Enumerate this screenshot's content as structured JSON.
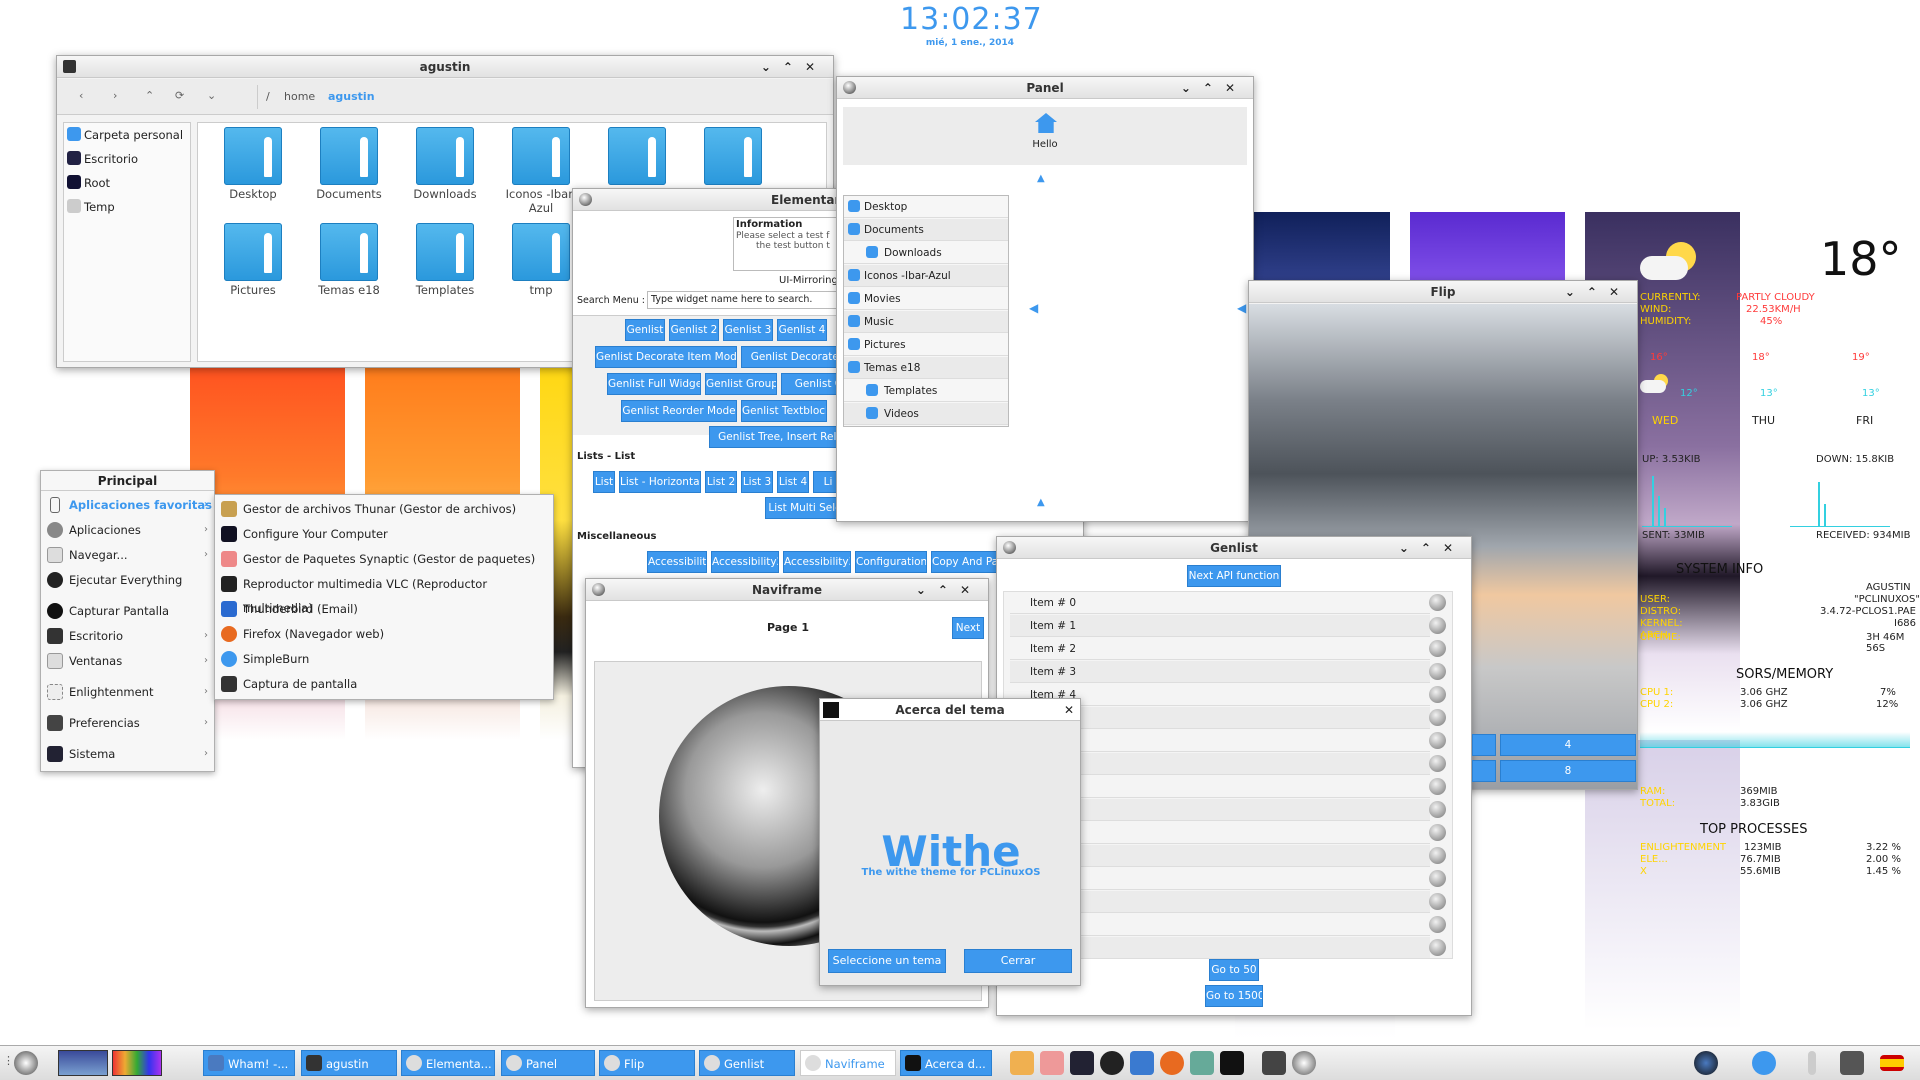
{
  "clock": {
    "time_a": "1",
    "time_b": "3",
    "time_c": "02",
    "time_d": "37",
    "date": "mié,  1 ene., 2014"
  },
  "filemanager": {
    "title": "agustin",
    "path": [
      "/",
      "home",
      "agustin"
    ],
    "places": [
      "Carpeta personal",
      "Escritorio",
      "Root",
      "Temp"
    ],
    "folders": [
      "Desktop",
      "Documents",
      "Downloads",
      "Iconos -Ibar-Azul",
      "",
      "",
      "Pictures",
      "Temas e18",
      "Templates",
      "tmp"
    ]
  },
  "elementary": {
    "title": "Elementar",
    "info_header": "Information",
    "info_text_1": "Please select a test f",
    "info_text_2": "the test button t",
    "mirroring": "UI-Mirroring",
    "search_label": "Search Menu :",
    "search_placeholder": "Type widget name here to search.",
    "genlist_buttons": [
      "Genlist",
      "Genlist 2",
      "Genlist 3",
      "Genlist 4",
      "Genlist Decorate Item Mode",
      "Genlist Decorate M",
      "Genlist Full Widget",
      "Genlist Group",
      "Genlist Gr",
      "Genlist Reorder Mode",
      "Genlist Textblock",
      "Genlist Tree, Insert Relati"
    ],
    "lists_header": "Lists - List",
    "list_buttons": [
      "List",
      "List - Horizontal",
      "List 2",
      "List 3",
      "List 4",
      "Li",
      "List Multi Sele"
    ],
    "misc_header": "Miscellaneous",
    "misc_buttons": [
      "Accessibility",
      "Accessibility2",
      "Accessibility3",
      "Configuration",
      "Copy And Paste"
    ]
  },
  "panel": {
    "title": "Panel",
    "hello": "Hello",
    "tree": [
      "Desktop",
      "Documents",
      "Downloads",
      "Iconos -Ibar-Azul",
      "Movies",
      "Music",
      "Pictures",
      "Temas e18",
      "Templates",
      "Videos"
    ]
  },
  "flip": {
    "title": "Flip"
  },
  "conky": {
    "temp": "18°",
    "current_label": "CURRENTLY:",
    "current_val": "PARTLY CLOUDY",
    "wind_label": "WIND:",
    "wind_val": "22.53KM/H",
    "hum_label": "HUMIDITY:",
    "hum_val": "45%",
    "days": [
      "WED",
      "THU",
      "FRI"
    ],
    "highs": [
      "16°",
      "18°",
      "19°"
    ],
    "lows": [
      "12°",
      "13°",
      "13°"
    ],
    "up": "UP: 3.53KIB",
    "down": "DOWN: 15.8KIB",
    "sent": "SENT: 33MIB",
    "received": "RECEIVED: 934MIB",
    "sysinfo_title": "SYSTEM INFO",
    "host": "AGUSTIN",
    "user_label": "USER:",
    "distro_label": "DISTRO:",
    "distro_val": "\"PCLINUXOS\"",
    "kernel_label": "KERNEL:",
    "kernel_val": "3.4.72-PCLOS1.PAE",
    "arch_label": "ARCH:",
    "arch_val": "I686",
    "uptime_label": "UPTIME:",
    "uptime_val": "3H 46M 56S",
    "sensors_title": "SORS/MEMORY",
    "cpu1_label": "CPU 1:",
    "cpu1_val": "3.06 GHZ",
    "cpu1_pct": "7%",
    "cpu2_label": "CPU 2:",
    "cpu2_val": "3.06 GHZ",
    "cpu2_pct": "12%",
    "ram_label": "RAM:",
    "ram_val": "369MIB",
    "total_label": "TOTAL:",
    "total_val": "3.83GIB",
    "top_title": "TOP PROCESSES",
    "procs": [
      {
        "name": "ENLIGHTENMENT",
        "mem": "123MIB",
        "cpu": "3.22 %"
      },
      {
        "name": "ELE...",
        "mem": "76.7MIB",
        "cpu": "2.00 %"
      },
      {
        "name": "X",
        "mem": "55.6MIB",
        "cpu": "1.45 %"
      }
    ]
  },
  "genlist": {
    "title": "Genlist",
    "next_btn": "Next API function",
    "items": [
      "Item # 0",
      "Item # 1",
      "Item # 2",
      "Item # 3",
      "Item # 4"
    ],
    "goto50": "Go to 50",
    "goto1500": "Go to 1500",
    "side_4": "4",
    "side_8": "8"
  },
  "naviframe": {
    "title": "Naviframe",
    "page": "Page 1",
    "next": "Next"
  },
  "about": {
    "title": "Acerca del tema",
    "logo_text": "Withe",
    "subtitle": "The withe theme for PCLinuxOS",
    "select_btn": "Seleccione un tema",
    "close_btn": "Cerrar"
  },
  "menu": {
    "title": "Principal",
    "items": [
      "Aplicaciones favoritas",
      "Aplicaciones",
      "Navegar...",
      "Ejecutar Everything",
      "Capturar Pantalla",
      "Escritorio",
      "Ventanas",
      "Enlightenment",
      "Preferencias",
      "Sistema"
    ],
    "submenu": [
      "Gestor de archivos Thunar (Gestor de archivos)",
      "Configure Your Computer",
      "Gestor de Paquetes Synaptic (Gestor de paquetes)",
      "Reproductor multimedia VLC (Reproductor multimedia)",
      "Thunderbird (Email)",
      "Firefox (Navegador web)",
      "SimpleBurn",
      "Captura de pantalla"
    ]
  },
  "taskbar": {
    "tasks": [
      "Wham! -...",
      "agustin",
      "Elementa...",
      "Panel",
      "Flip",
      "Genlist",
      "Naviframe",
      "Acerca d..."
    ]
  },
  "colors": {
    "accent": "#3d98ee",
    "conky_label": "#ffd400",
    "conky_red": "#ff3a3a",
    "conky_cyan": "#33d0e0"
  }
}
